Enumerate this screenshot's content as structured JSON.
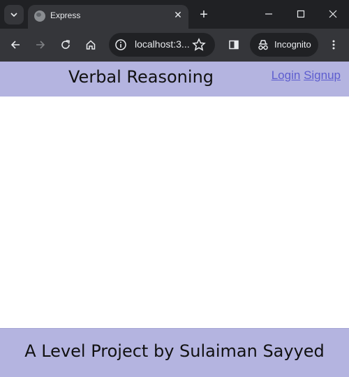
{
  "browser": {
    "tab": {
      "title": "Express",
      "favicon": "globe-icon"
    },
    "address": "localhost:3...",
    "incognito_label": "Incognito"
  },
  "page": {
    "header": {
      "title": "Verbal Reasoning",
      "login_label": "Login",
      "signup_label": "Signup"
    },
    "footer": {
      "text": "A Level Project by Sulaiman Sayyed"
    }
  },
  "colors": {
    "header_bg": "#b4b4e0",
    "footer_bg": "#b4b4e0",
    "link": "#5d5dcf",
    "chrome_dark": "#202124",
    "chrome_toolbar": "#35363a"
  }
}
